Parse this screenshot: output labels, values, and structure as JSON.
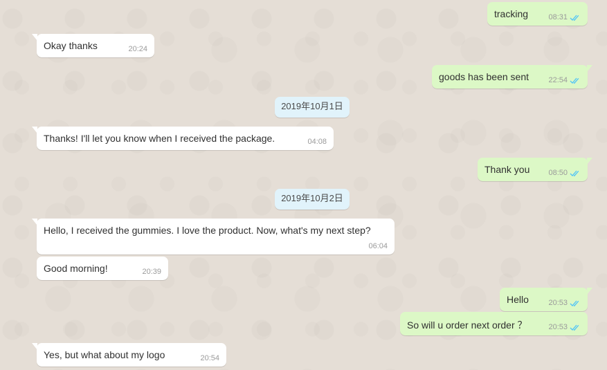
{
  "colors": {
    "background": "#e5ded6",
    "incoming_bubble": "#ffffff",
    "outgoing_bubble": "#dcf8c6",
    "date_chip": "#e1f3fb",
    "read_ticks": "#4fc3f7"
  },
  "messages": [
    {
      "direction": "out",
      "text": "tracking",
      "time": "08:31",
      "read": true
    },
    {
      "direction": "in",
      "text": "Okay thanks",
      "time": "20:24"
    },
    {
      "direction": "out",
      "text": "goods has been sent",
      "time": "22:54",
      "read": true
    },
    {
      "direction": "in",
      "text": "Thanks! I'll let you know when I received the package.",
      "time": "04:08"
    },
    {
      "direction": "out",
      "text": "Thank you",
      "time": "08:50",
      "read": true
    },
    {
      "direction": "in",
      "text": "Hello,  I received the gummies.  I love the product.  Now, what's my next step?",
      "time": "06:04"
    },
    {
      "direction": "in",
      "text": "Good morning!",
      "time": "20:39"
    },
    {
      "direction": "out",
      "text": "Hello",
      "time": "20:53",
      "read": true
    },
    {
      "direction": "out",
      "text": "So will u order next order ？",
      "time": "20:53",
      "read": true
    },
    {
      "direction": "in",
      "text": "Yes, but what about my logo",
      "time": "20:54"
    }
  ],
  "dates": [
    "2019年10月1日",
    "2019年10月2日"
  ]
}
